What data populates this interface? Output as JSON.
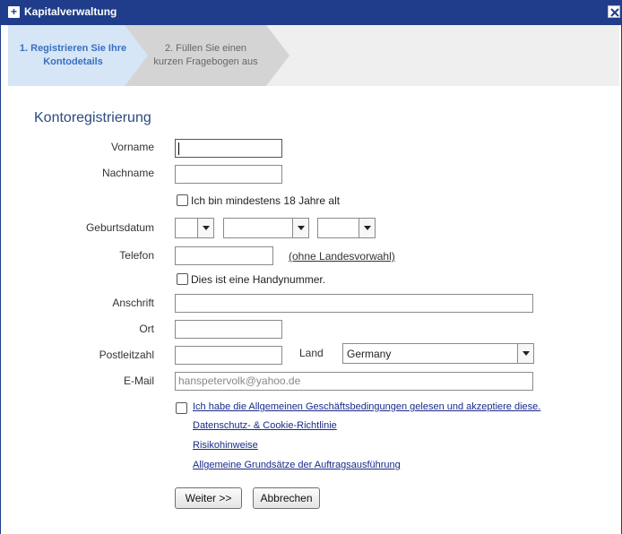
{
  "window": {
    "title": "Kapitalverwaltung"
  },
  "steps": [
    {
      "line1": "1. Registrieren Sie Ihre",
      "line2": "Kontodetails"
    },
    {
      "line1": "2. Füllen Sie einen",
      "line2": "kurzen Fragebogen aus"
    }
  ],
  "form": {
    "heading": "Kontoregistrierung",
    "labels": {
      "vorname": "Vorname",
      "nachname": "Nachname",
      "geburtsdatum": "Geburtsdatum",
      "telefon": "Telefon",
      "anschrift": "Anschrift",
      "ort": "Ort",
      "postleitzahl": "Postleitzahl",
      "land": "Land",
      "email": "E-Mail"
    },
    "values": {
      "vorname": "",
      "nachname": "",
      "telefon": "",
      "anschrift": "",
      "ort": "",
      "postleitzahl": "",
      "land": "Germany",
      "email": "hanspetervolk@yahoo.de",
      "day": "",
      "month": "",
      "year": ""
    },
    "age_checkbox": "Ich bin mindestens 18 Jahre alt",
    "mobile_checkbox": "Dies ist eine Handynummer.",
    "phone_hint": "(ohne Landesvorwahl)",
    "terms_checkbox": "Ich habe die Allgemeinen Geschäftsbedingungen gelesen und akzeptiere diese.",
    "links": [
      "Datenschutz- & Cookie-Richtlinie",
      "Risikohinweise",
      "Allgemeine Grundsätze der Auftragsausführung"
    ],
    "buttons": {
      "next": "Weiter >>",
      "cancel": "Abbrechen"
    }
  },
  "colors": {
    "titlebar": "#1f3d8a",
    "active_step": "#d6e6f7",
    "inactive_step": "#d4d4d4",
    "heading": "#2a4a80",
    "link": "#1a2a8a"
  }
}
